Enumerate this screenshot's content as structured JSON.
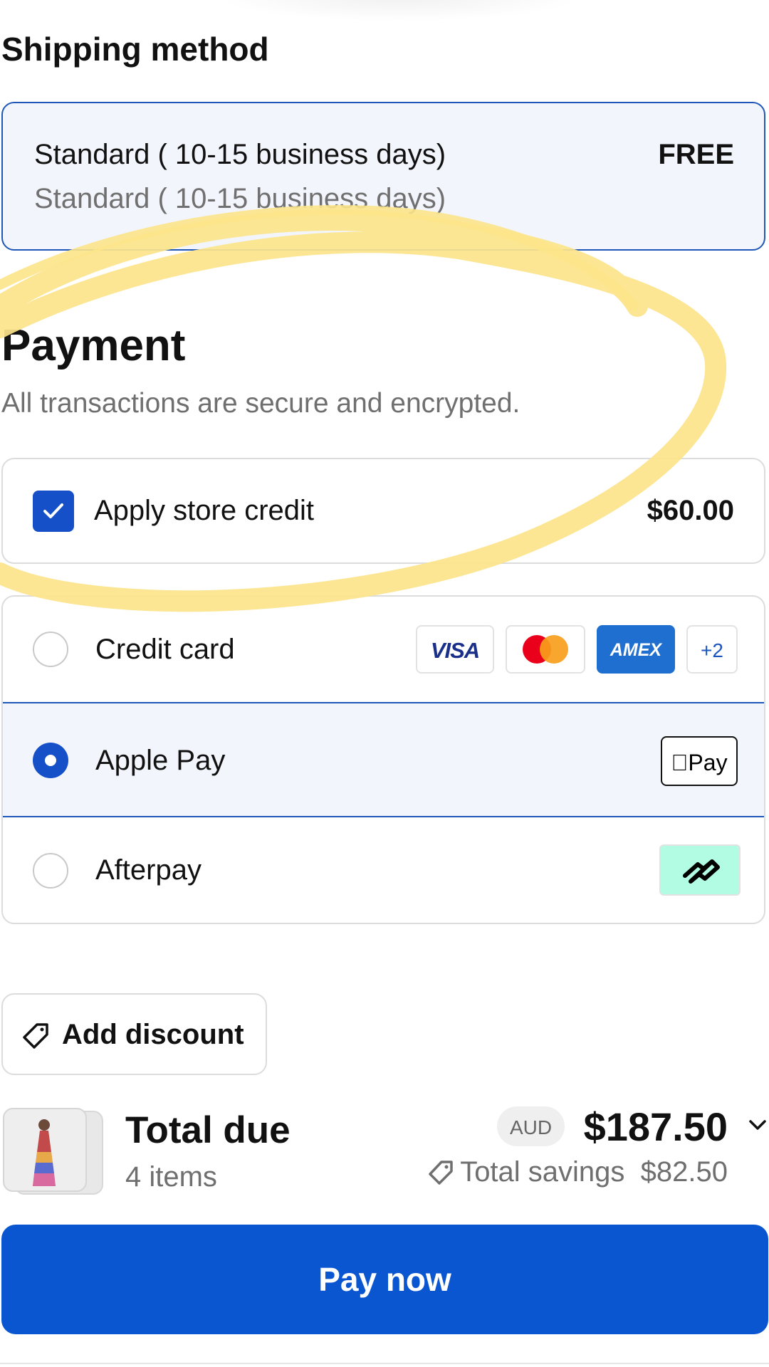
{
  "shipping": {
    "title": "Shipping method",
    "option_name": "Standard ( 10-15 business days)",
    "option_sub": "Standard ( 10-15 business days)",
    "price": "FREE"
  },
  "payment": {
    "title": "Payment",
    "subtitle": "All transactions are secure and encrypted.",
    "store_credit": {
      "label": "Apply store credit",
      "amount": "$60.00",
      "checked": true
    },
    "methods": [
      {
        "label": "Credit card",
        "selected": false
      },
      {
        "label": "Apple Pay",
        "selected": true
      },
      {
        "label": "Afterpay",
        "selected": false
      }
    ],
    "card_logos": {
      "visa": "VISA",
      "amex": "AMEX",
      "more": "+2"
    },
    "apple_pay_badge": "Pay"
  },
  "discount": {
    "label": "Add discount"
  },
  "summary": {
    "title": "Total due",
    "items": "4 items",
    "currency": "AUD",
    "total": "$187.50",
    "savings_label": "Total savings",
    "savings_amount": "$82.50"
  },
  "pay_button": {
    "label": "Pay now"
  },
  "colors": {
    "accent": "#0a56d1",
    "selected_bg": "#f3f5fc",
    "afterpay": "#b2fce4",
    "highlight": "#fce48a"
  }
}
